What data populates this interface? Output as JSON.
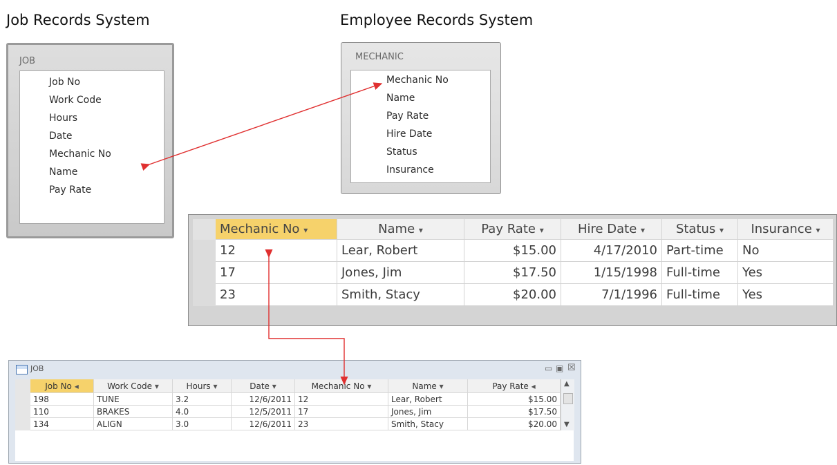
{
  "headings": {
    "left": "Job Records System",
    "right": "Employee Records System"
  },
  "job_box": {
    "title": "JOB",
    "fields": [
      "Job No",
      "Work Code",
      "Hours",
      "Date",
      "Mechanic No",
      "Name",
      "Pay Rate"
    ]
  },
  "mechanic_box": {
    "title": "MECHANIC",
    "fields": [
      "Mechanic No",
      "Name",
      "Pay Rate",
      "Hire Date",
      "Status",
      "Insurance"
    ]
  },
  "mechanic_table": {
    "columns": [
      "Mechanic No",
      "Name",
      "Pay Rate",
      "Hire Date",
      "Status",
      "Insurance"
    ],
    "rows": [
      [
        "12",
        "Lear, Robert",
        "$15.00",
        "4/17/2010",
        "Part-time",
        "No"
      ],
      [
        "17",
        "Jones, Jim",
        "$17.50",
        "1/15/1998",
        "Full-time",
        "Yes"
      ],
      [
        "23",
        "Smith, Stacy",
        "$20.00",
        "7/1/1996",
        "Full-time",
        "Yes"
      ]
    ]
  },
  "job_table": {
    "window_title": "JOB",
    "columns": [
      "Job No",
      "Work Code",
      "Hours",
      "Date",
      "Mechanic No",
      "Name",
      "Pay Rate"
    ],
    "rows": [
      [
        "198",
        "TUNE",
        "3.2",
        "12/6/2011",
        "12",
        "Lear, Robert",
        "$15.00"
      ],
      [
        "110",
        "BRAKES",
        "4.0",
        "12/5/2011",
        "17",
        "Jones, Jim",
        "$17.50"
      ],
      [
        "134",
        "ALIGN",
        "3.0",
        "12/6/2011",
        "23",
        "Smith, Stacy",
        "$20.00"
      ]
    ]
  },
  "colors": {
    "arrow": "#e03030",
    "header_highlight": "#f6d26b",
    "row_selector": "#dcdcdc"
  }
}
